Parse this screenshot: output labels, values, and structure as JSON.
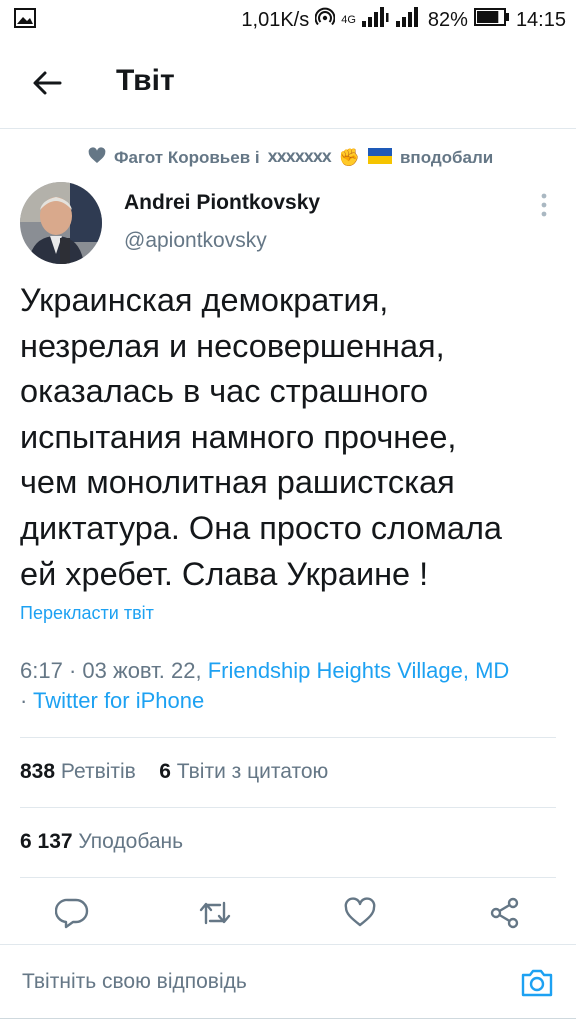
{
  "status_bar": {
    "network_speed": "1,01K/s",
    "network_type": "4G",
    "battery_percent": "82%",
    "battery_level": 0.82,
    "time": "14:15",
    "icons": [
      "image-notification-icon",
      "hotspot-icon",
      "signal-icon",
      "signal-icon",
      "battery-icon"
    ]
  },
  "header": {
    "title": "Твіт",
    "back_icon": "back-arrow-icon"
  },
  "tweet": {
    "social_context": {
      "icon": "heart-icon",
      "prefix": "Фагот Коровьев і",
      "blocked_glyphs": "𝗫𝗫𝗫𝗫𝗫𝗫𝗫",
      "emoji_fist": "✊",
      "suffix": "вподобали"
    },
    "author": {
      "name": "Andrei Piontkovsky",
      "handle": "@apiontkovsky"
    },
    "text": "Украинская демократия,\nнезрелая и несовершенная,\nоказалась в час страшного\nиспытания намного прочнее,\nчем монолитная рашистская\nдиктатура. Она просто сломала\nей хребет. Слава Украине !",
    "translate_label": "Перекласти твіт",
    "time": "6:17",
    "date_separator": " · ",
    "date": "03 жовт. 22",
    "place": "Friendship Heights Village, MD",
    "source_separator": "· ",
    "source": "Twitter for iPhone"
  },
  "stats": {
    "retweets_count": "838",
    "retweets_label": "Ретвітів",
    "quotes_count": "6",
    "quotes_label": "Твіти з цитатою",
    "likes_count": "6 137",
    "likes_label": "Уподобань"
  },
  "actions": [
    "reply-icon",
    "retweet-icon",
    "like-icon",
    "share-icon"
  ],
  "reply_box": {
    "placeholder": "Твітніть свою відповідь",
    "camera_icon": "camera-icon"
  },
  "colors": {
    "accent": "#1da1f2",
    "text_primary": "#14171a",
    "text_secondary": "#657786",
    "divider": "#e1e8ed"
  }
}
